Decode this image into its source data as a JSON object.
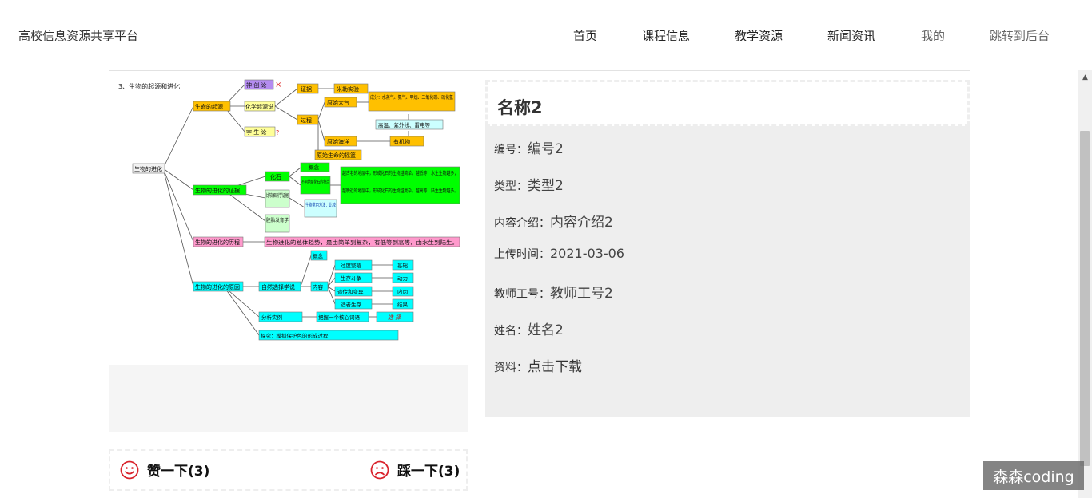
{
  "header": {
    "brand": "高校信息资源共享平台",
    "nav": [
      {
        "label": "首页"
      },
      {
        "label": "课程信息"
      },
      {
        "label": "教学资源"
      },
      {
        "label": "新闻资讯"
      },
      {
        "label": "我的"
      },
      {
        "label": "跳转到后台"
      }
    ]
  },
  "diagram": {
    "heading": "3、生物的起源和进化",
    "root": "生物的进化",
    "nodes": {
      "origin": "生命的起源",
      "creation": "神 创 论",
      "chem": "化学起源说",
      "universe": "宇 生 论",
      "evidence_top": "证据",
      "miller": "米勒实验",
      "process": "过程",
      "atmos": "原始大气",
      "components": "成分：水蒸气、氨气、甲烷、二氧化碳、硫化氢",
      "energy": "高温、紫外线、雷电等",
      "ocean": "原始海洋",
      "organic": "有机物",
      "cradle": "原始生命的摇篮",
      "evo_evidence": "生物的进化的证据",
      "fossil": "化石",
      "concept1": "概念",
      "strata": "不同地层化石的特点",
      "fossil_old": "越古老的地层中，形成化石的生物越简单，越低等，水生生物越多；",
      "fossil_new": "越晚近的地层中，形成化石的生物越复杂，越高等，陆生生物越多。",
      "anatomy": "比较解剖学证据",
      "method": "生物常用方法：比较",
      "embryo": "胚胎发育学",
      "evo_history": "生物的进化的历程",
      "trend": "生物进化的总体趋势，是由简单到复杂，有低等到高等，由水生到陆生。",
      "evo_cause": "生物的进化的原因",
      "selection": "自然选择学说",
      "concept2": "概念",
      "content": "内容",
      "overbreed": "过度繁殖",
      "basis": "基础",
      "struggle": "生存斗争",
      "motive": "动力",
      "heredity": "遗传和变异",
      "internal": "内因",
      "survival": "适者生存",
      "result": "结果",
      "example": "分析实例",
      "keyword": "把握一个核心词语",
      "select_word": "选 择",
      "explore": "探究：模拟保护色的形成过程"
    },
    "cross_mark": "×",
    "question_mark": "?"
  },
  "votes": {
    "like_label": "赞一下(3)",
    "dislike_label": "踩一下(3)"
  },
  "detail": {
    "title": "名称2",
    "fields": [
      {
        "label": "编号：",
        "value": "编号2"
      },
      {
        "label": "类型：",
        "value": "类型2"
      },
      {
        "label": "内容介绍：",
        "value": "内容介绍2"
      },
      {
        "label": "上传时间：",
        "value": "2021-03-06"
      },
      {
        "label": "教师工号：",
        "value": "教师工号2"
      },
      {
        "label": "姓名：",
        "value": "姓名2"
      },
      {
        "label": "资料：",
        "value": "点击下载"
      }
    ]
  },
  "watermark": "森森coding",
  "colors": {
    "orange": "#ffc000",
    "purple": "#b48cf0",
    "yellow": "#ffff99",
    "green": "#00ff00",
    "pink": "#ff99cc",
    "cyan": "#00ffff",
    "lightblue": "#ccffff",
    "vote_red": "#d9232c"
  }
}
